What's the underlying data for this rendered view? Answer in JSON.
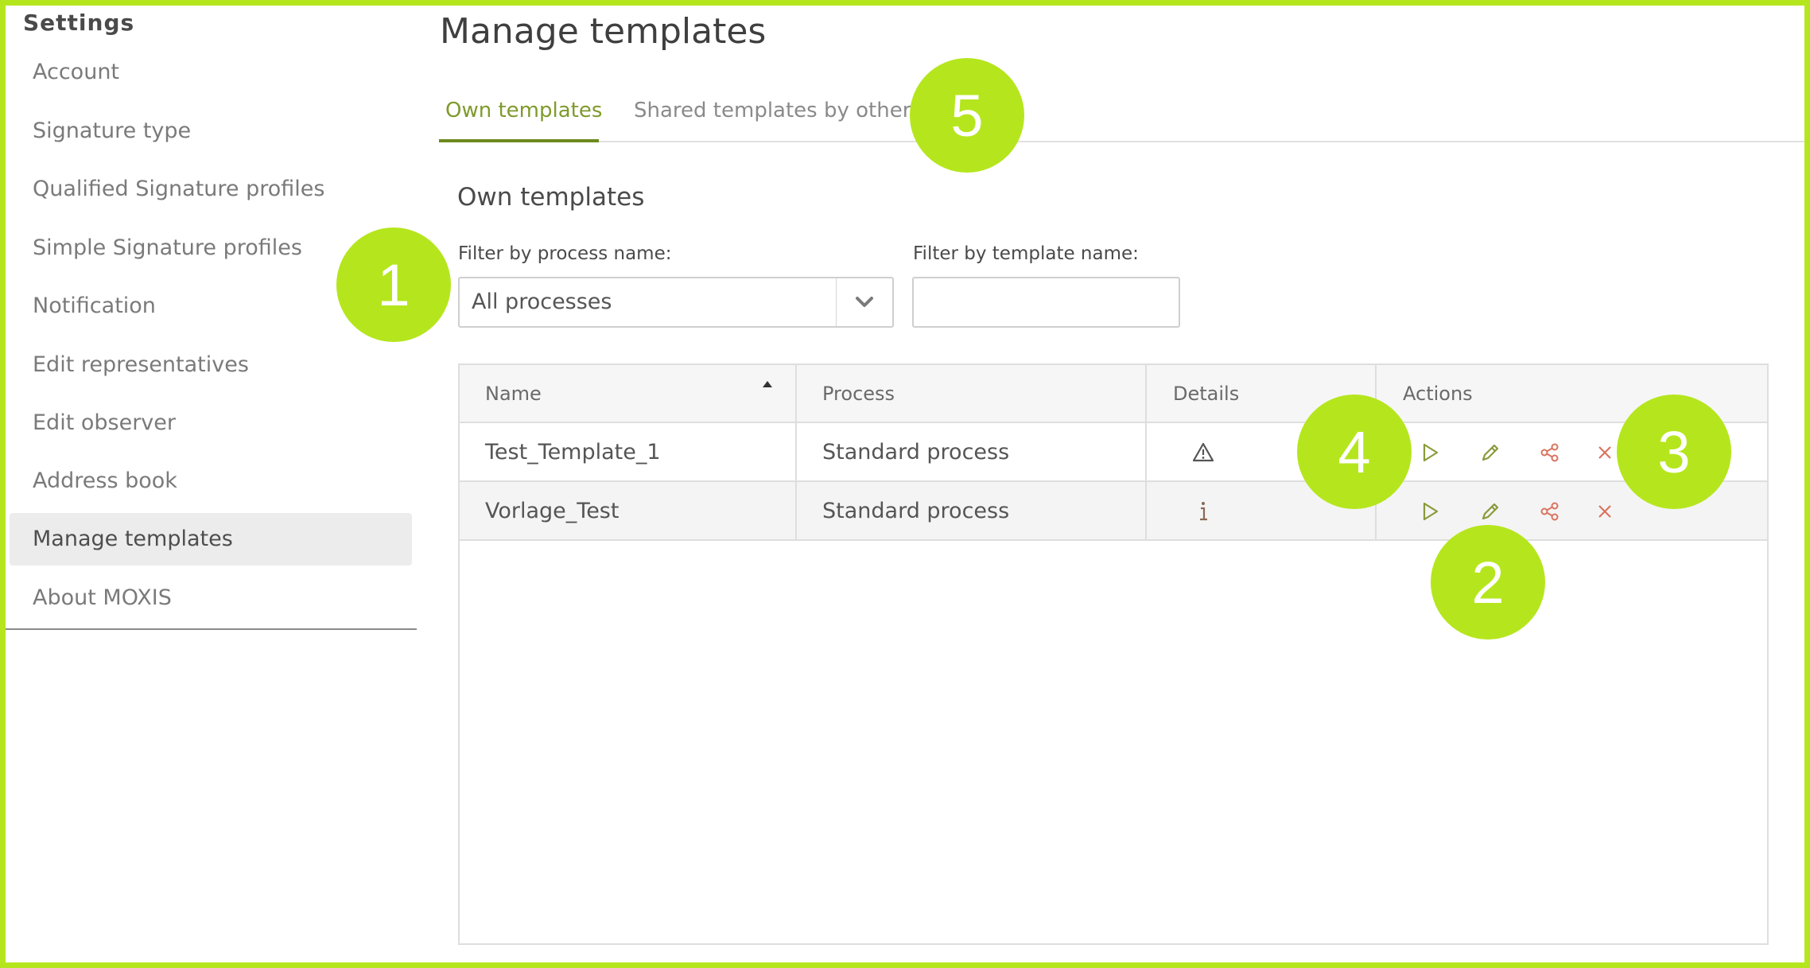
{
  "sidebar": {
    "title": "Settings",
    "items": [
      {
        "label": "Account",
        "active": false
      },
      {
        "label": "Signature type",
        "active": false
      },
      {
        "label": "Qualified Signature profiles",
        "active": false
      },
      {
        "label": "Simple Signature profiles",
        "active": false
      },
      {
        "label": "Notification",
        "active": false
      },
      {
        "label": "Edit representatives",
        "active": false
      },
      {
        "label": "Edit observer",
        "active": false
      },
      {
        "label": "Address book",
        "active": false
      },
      {
        "label": "Manage templates",
        "active": true
      },
      {
        "label": "About MOXIS",
        "active": false
      }
    ]
  },
  "main": {
    "title": "Manage templates",
    "tabs": [
      {
        "label": "Own templates",
        "active": true
      },
      {
        "label": "Shared templates by others",
        "active": false
      }
    ],
    "section_title": "Own templates",
    "filters": {
      "process_label": "Filter by process name:",
      "process_value": "All processes",
      "template_label": "Filter by template name:",
      "template_value": "",
      "template_placeholder": ""
    },
    "table": {
      "columns": [
        "Name",
        "Process",
        "Details",
        "Actions"
      ],
      "sort": {
        "column": "Name",
        "direction": "ascending"
      },
      "rows": [
        {
          "name": "Test_Template_1",
          "process": "Standard process",
          "details_icon": "warning-icon",
          "actions": [
            "play-icon",
            "pencil-icon",
            "share-icon",
            "close-icon"
          ]
        },
        {
          "name": "Vorlage_Test",
          "process": "Standard process",
          "details_icon": "info-icon",
          "actions": [
            "play-icon",
            "pencil-icon",
            "share-icon",
            "close-icon"
          ]
        }
      ]
    }
  },
  "annotations": [
    "1",
    "2",
    "3",
    "4",
    "5"
  ],
  "colors": {
    "annotation": "#b5e61d",
    "active_tab": "#7f9a2c",
    "action_green": "#8a9a3a",
    "action_red": "#d9745f"
  }
}
